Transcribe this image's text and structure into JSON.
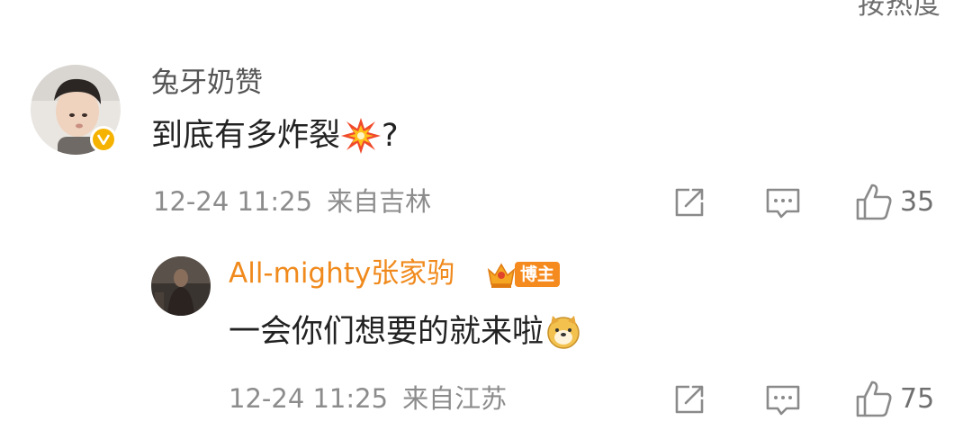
{
  "header": {
    "sort_label": "按热度"
  },
  "comments": [
    {
      "username": "兔牙奶赞",
      "username_color": "#555555",
      "text": "到底有多炸裂",
      "text_suffix": "?",
      "emoji": "explosion-icon",
      "timestamp": "12-24 11:25",
      "location": "来自吉林",
      "verified": true,
      "likes": "35"
    },
    {
      "username": "All-mighty张家驹",
      "username_color": "#f08a1d",
      "badge": "博主",
      "text": "一会你们想要的就来啦",
      "emoji": "doge-icon",
      "timestamp": "12-24 11:25",
      "location": "来自江苏",
      "likes": "75"
    }
  ]
}
